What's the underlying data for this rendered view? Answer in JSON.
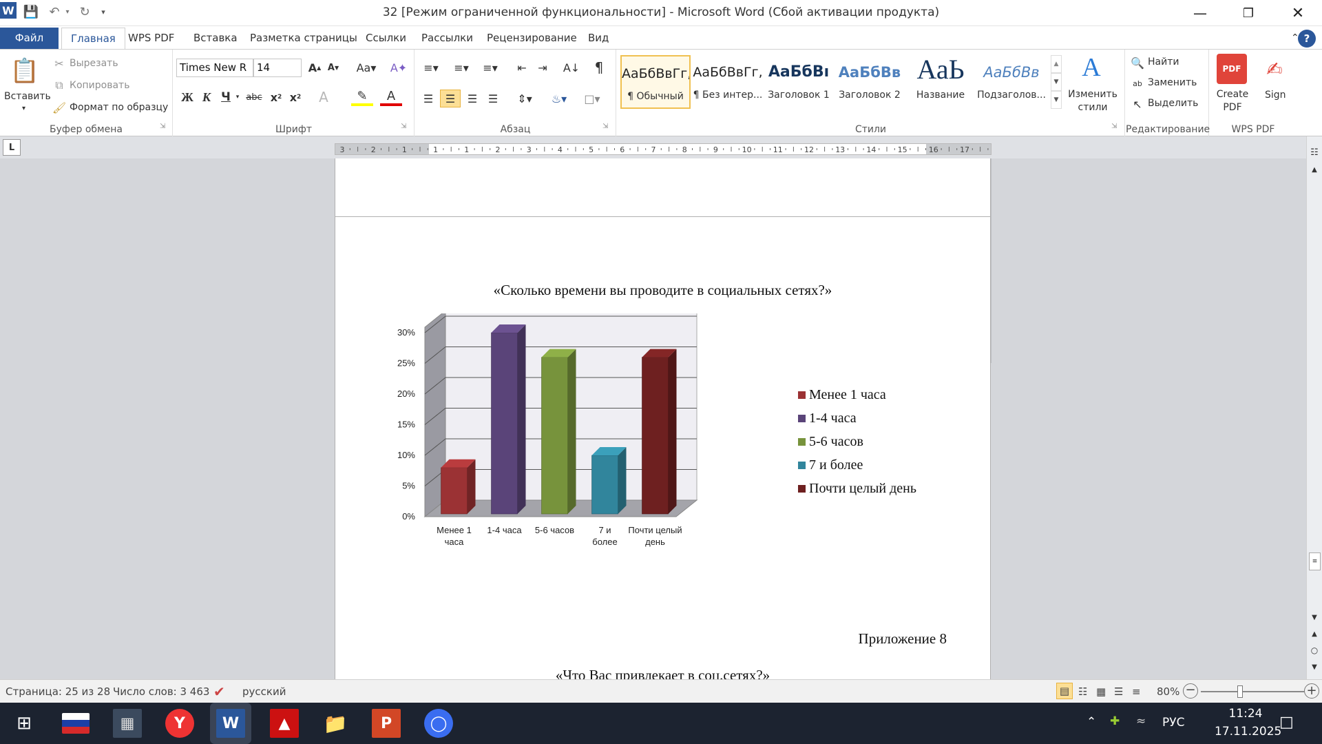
{
  "window": {
    "title": "32 [Режим ограниченной функциональности]  -  Microsoft Word (Сбой активации продукта)"
  },
  "tabs": [
    "Файл",
    "Главная",
    "WPS PDF",
    "Вставка",
    "Разметка страницы",
    "Ссылки",
    "Рассылки",
    "Рецензирование",
    "Вид"
  ],
  "ribbon": {
    "clipboard": {
      "paste": "Вставить",
      "cut": "Вырезать",
      "copy": "Копировать",
      "format_painter": "Формат по образцу",
      "label": "Буфер обмена"
    },
    "font": {
      "name": "Times New R",
      "size": "14",
      "label": "Шрифт"
    },
    "paragraph": {
      "label": "Абзац"
    },
    "styles": {
      "items": [
        {
          "preview": "АаБбВвГг,",
          "name": "¶ Обычный"
        },
        {
          "preview": "АаБбВвГг,",
          "name": "¶ Без интер..."
        },
        {
          "preview": "АаБбВı",
          "name": "Заголовок 1"
        },
        {
          "preview": "АаБбВв",
          "name": "Заголовок 2"
        },
        {
          "preview": "АаЬ",
          "name": "Название"
        },
        {
          "preview": "АаБбВв",
          "name": "Подзаголов..."
        }
      ],
      "change_styles": "Изменить стили",
      "label": "Стили"
    },
    "editing": {
      "find": "Найти",
      "replace": "Заменить",
      "select": "Выделить",
      "label": "Редактирование"
    },
    "wps": {
      "create_pdf": "Create PDF",
      "sign": "Sign",
      "label": "WPS PDF"
    }
  },
  "ruler": {
    "numbers": [
      "3",
      "2",
      "1",
      "1",
      "1",
      "2",
      "3",
      "4",
      "5",
      "6",
      "7",
      "8",
      "9",
      "10",
      "11",
      "12",
      "13",
      "14",
      "15",
      "16",
      "17"
    ]
  },
  "document": {
    "chart_heading": "«Сколько времени вы проводите в социальных сетях?»",
    "appendix": "Приложение 8",
    "next_heading_prefix": "«Что Вас привлекает в ",
    "next_heading_underlined": "соц.сетях",
    "next_heading_suffix": "?»"
  },
  "chart_data": {
    "type": "bar",
    "categories": [
      "Менее 1 часа",
      "1-4 часа",
      "5-6 часов",
      "7 и более",
      "Почти целый день"
    ],
    "values": [
      8,
      30,
      26,
      10,
      26
    ],
    "ylim": [
      0,
      30
    ],
    "yticks": [
      "0%",
      "5%",
      "10%",
      "15%",
      "20%",
      "25%",
      "30%"
    ],
    "colors": [
      "#9b3234",
      "#5a4479",
      "#77933c",
      "#31859c",
      "#6e2020"
    ],
    "legend": [
      "Менее 1 часа",
      "1-4 часа",
      "5-6 часов",
      "7 и более",
      "Почти целый день"
    ],
    "legend_position": "right",
    "grid": true,
    "style": "3d-column"
  },
  "status": {
    "page": "Страница: 25 из 28",
    "words": "Число слов: 3 463",
    "language": "русский",
    "zoom": "80%"
  },
  "taskbar": {
    "lang": "РУС",
    "time": "11:24",
    "date": "17.11.2025"
  }
}
